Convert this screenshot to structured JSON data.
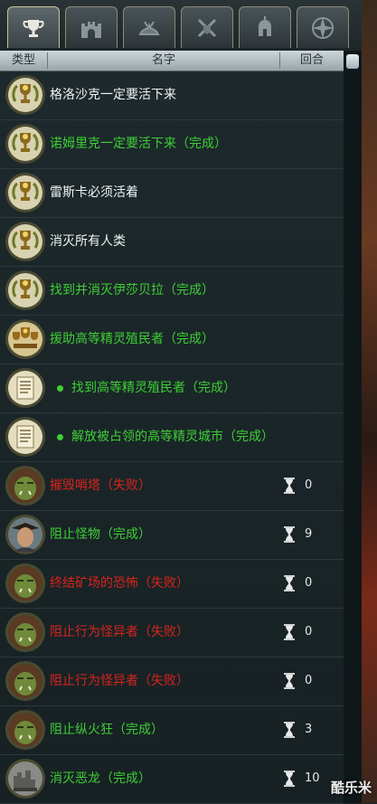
{
  "tabs": [
    {
      "icon": "trophy-icon",
      "active": true
    },
    {
      "icon": "castle-icon",
      "active": false
    },
    {
      "icon": "creature-icon",
      "active": false
    },
    {
      "icon": "crossed-swords-icon",
      "active": false
    },
    {
      "icon": "helmet-icon",
      "active": false
    },
    {
      "icon": "compass-icon",
      "active": false
    }
  ],
  "header": {
    "type": "类型",
    "name": "名字",
    "turns": "回合"
  },
  "quests": [
    {
      "name": "格洛沙克一定要活下来",
      "color": "white",
      "icon": "trophy-laurel-icon"
    },
    {
      "name": "诺姆里克一定要活下来（完成）",
      "color": "green",
      "icon": "trophy-laurel-icon"
    },
    {
      "name": "雷斯卡必须活着",
      "color": "white",
      "icon": "trophy-laurel-icon"
    },
    {
      "name": "消灭所有人类",
      "color": "white",
      "icon": "trophy-laurel-icon"
    },
    {
      "name": "找到并消灭伊莎贝拉（完成）",
      "color": "green",
      "icon": "trophy-laurel-icon"
    },
    {
      "name": "援助高等精灵殖民者（完成）",
      "color": "green",
      "icon": "triple-trophy-icon"
    },
    {
      "name": "找到高等精灵殖民者（完成）",
      "color": "green",
      "icon": "scroll-icon",
      "sub": true
    },
    {
      "name": "解放被占领的高等精灵城市（完成）",
      "color": "green",
      "icon": "scroll-icon",
      "sub": true
    },
    {
      "name": "摧毁哨塔（失败）",
      "color": "red",
      "icon": "orc-portrait-icon",
      "turns": "0"
    },
    {
      "name": "阻止怪物（完成）",
      "color": "green",
      "icon": "hero-portrait-icon",
      "turns": "9"
    },
    {
      "name": "终结矿场的恐怖（失败）",
      "color": "red",
      "icon": "orc-portrait-icon",
      "turns": "0"
    },
    {
      "name": "阻止行为怪异者（失败）",
      "color": "red",
      "icon": "orc-portrait-icon",
      "turns": "0"
    },
    {
      "name": "阻止行为怪异者（失败）",
      "color": "red",
      "icon": "orc-portrait-icon",
      "turns": "0"
    },
    {
      "name": "阻止纵火狂（完成）",
      "color": "green",
      "icon": "orc-portrait-icon",
      "turns": "3"
    },
    {
      "name": "消灭恶龙（完成）",
      "color": "green",
      "icon": "ruins-portrait-icon",
      "turns": "10"
    }
  ],
  "watermark": "酷乐米"
}
